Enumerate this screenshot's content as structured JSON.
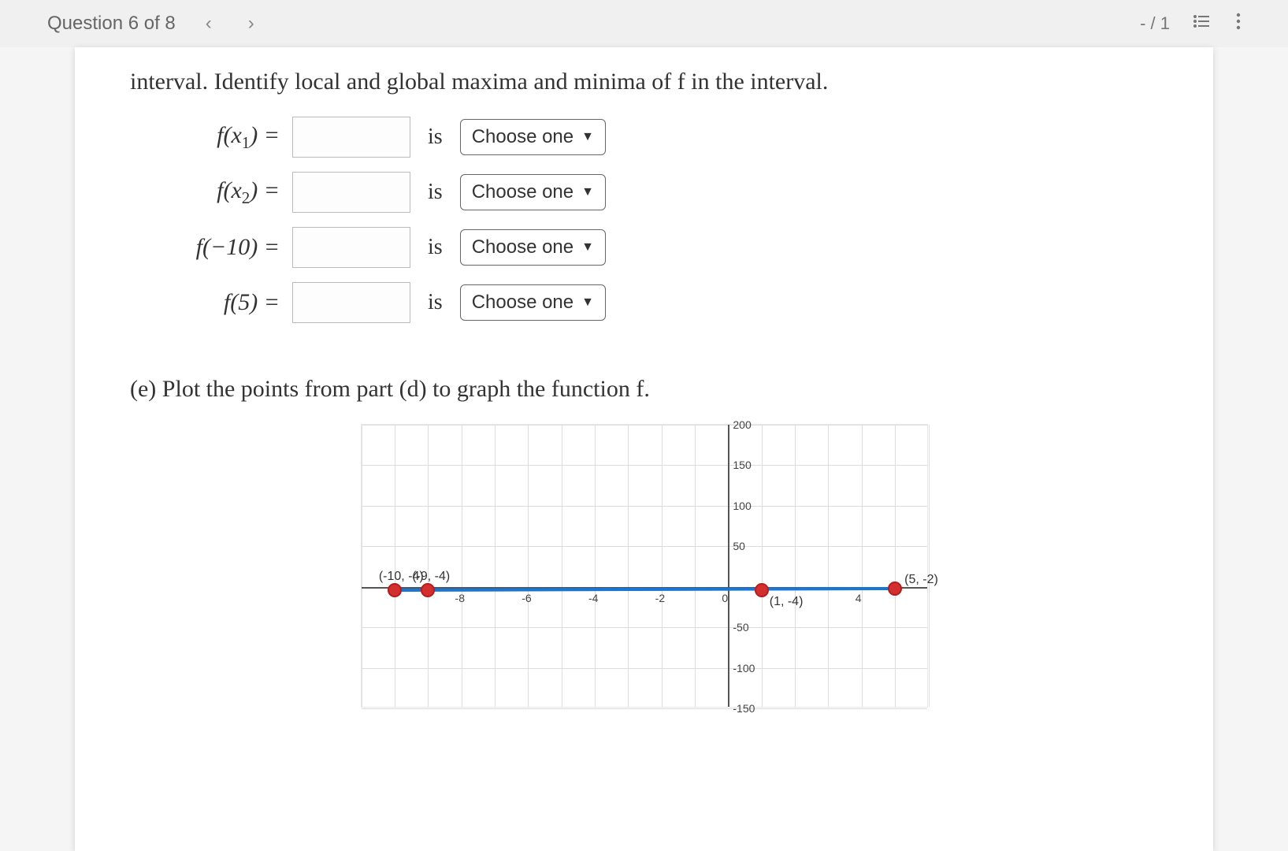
{
  "toolbar": {
    "question_label": "Question 6 of 8",
    "score": "- / 1"
  },
  "prompt": "interval. Identify local and global maxima and minima of f in the interval.",
  "rows": [
    {
      "label_html": "f(x1)",
      "fname": "f",
      "arg_prefix": "x",
      "arg_sub": "1",
      "arg_suffix": "",
      "is": "is",
      "dropdown": "Choose one"
    },
    {
      "label_html": "f(x2)",
      "fname": "f",
      "arg_prefix": "x",
      "arg_sub": "2",
      "arg_suffix": "",
      "is": "is",
      "dropdown": "Choose one"
    },
    {
      "label_html": "f(-10)",
      "fname": "f",
      "arg_prefix": "−10",
      "arg_sub": "",
      "arg_suffix": "",
      "is": "is",
      "dropdown": "Choose one"
    },
    {
      "label_html": "f(5)",
      "fname": "f",
      "arg_prefix": "5",
      "arg_sub": "",
      "arg_suffix": "",
      "is": "is",
      "dropdown": "Choose one"
    }
  ],
  "part_e": "(e) Plot the points from part (d) to graph the function f.",
  "chart_data": {
    "type": "scatter",
    "title": "",
    "xlabel": "",
    "ylabel": "",
    "xlim": [
      -11,
      6
    ],
    "ylim": [
      -150,
      200
    ],
    "x_ticks": [
      -8,
      -6,
      -4,
      -2,
      0,
      4
    ],
    "y_ticks": [
      -150,
      -100,
      -50,
      0,
      50,
      100,
      150,
      200
    ],
    "points": [
      {
        "x": -10,
        "y": -4,
        "label": "(-10, -4)"
      },
      {
        "x": -9,
        "y": -4,
        "label": "(-9, -4)"
      },
      {
        "x": 1,
        "y": -4,
        "label": "(1, -4)"
      },
      {
        "x": 5,
        "y": -2,
        "label": "(5, -2)"
      }
    ],
    "line_segment": {
      "x1": -10,
      "y1": -4,
      "x2": 5,
      "y2": -2
    }
  }
}
